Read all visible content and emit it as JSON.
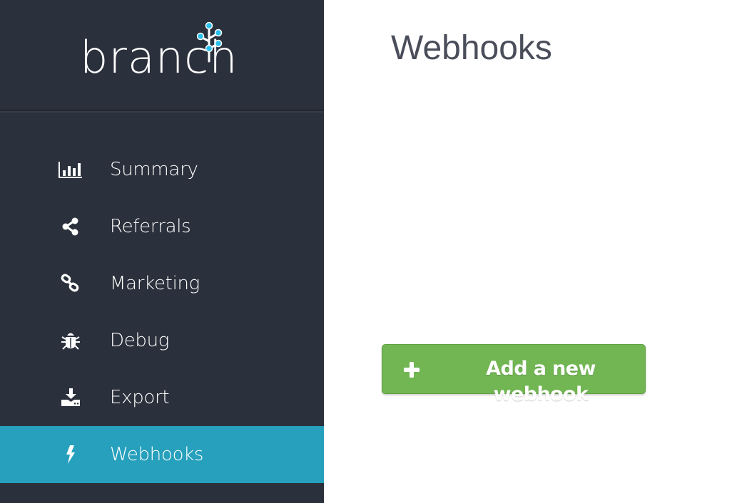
{
  "app": {
    "logo_text": "branch",
    "colors": {
      "sidebar_bg": "#2b313c",
      "active_item_bg": "#26a0bc",
      "logo_accent": "#29c0ec",
      "button_green": "#72b654",
      "title_text": "#4a4d5a"
    }
  },
  "sidebar": {
    "items": [
      {
        "label": "Summary",
        "icon": "bar-chart-icon",
        "active": false
      },
      {
        "label": "Referrals",
        "icon": "share-icon",
        "active": false
      },
      {
        "label": "Marketing",
        "icon": "link-icon",
        "active": false
      },
      {
        "label": "Debug",
        "icon": "bug-icon",
        "active": false
      },
      {
        "label": "Export",
        "icon": "download-icon",
        "active": false
      },
      {
        "label": "Webhooks",
        "icon": "bolt-icon",
        "active": true
      }
    ]
  },
  "main": {
    "title": "Webhooks",
    "add_button": {
      "label": "Add a new webhook",
      "icon": "plus-icon"
    }
  }
}
